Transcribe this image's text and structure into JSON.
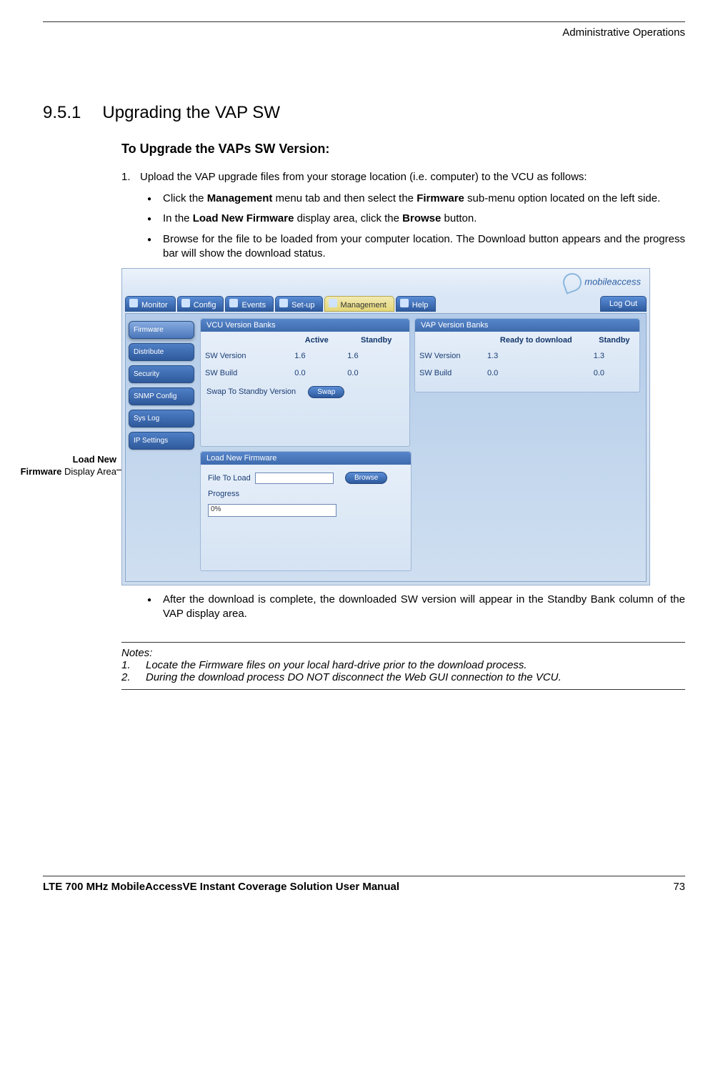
{
  "header_right": "Administrative Operations",
  "section": {
    "num": "9.5.1",
    "title": "Upgrading the VAP SW"
  },
  "sub_h": "To Upgrade the VAPs SW Version:",
  "step1_num": "1.",
  "step1": "Upload the VAP upgrade files from your storage location (i.e. computer) to the VCU as follows:",
  "bullets": {
    "b1_a": "Click the ",
    "b1_b": "Management",
    "b1_c": " menu tab and then select the ",
    "b1_d": "Firmware",
    "b1_e": " sub-menu option located on the left side.",
    "b2_a": "In the ",
    "b2_b": "Load New Firmware",
    "b2_c": " display area, click the ",
    "b2_d": "Browse",
    "b2_e": " button.",
    "b3": "Browse for the file to be loaded from your computer location. The Download button appears and the progress bar will show the download status.",
    "b4": "After the download is complete, the downloaded SW version will appear in the Standby Bank column of the VAP display area."
  },
  "callout_a": "Load New",
  "callout_b": "Firmware",
  "callout_c": " Display Area",
  "app": {
    "brand": "mobileaccess",
    "tabs": [
      "Monitor",
      "Config",
      "Events",
      "Set-up",
      "Management",
      "Help"
    ],
    "selected_tab": "Management",
    "logout": "Log Out",
    "side": [
      "Firmware",
      "Distribute",
      "Security",
      "SNMP Config",
      "Sys Log",
      "IP Settings"
    ],
    "selected_side": "Firmware",
    "vcu": {
      "title": "VCU Version Banks",
      "cols": [
        "",
        "Active",
        "Standby"
      ],
      "rows": [
        [
          "SW Version",
          "1.6",
          "1.6"
        ],
        [
          "SW Build",
          "0.0",
          "0.0"
        ]
      ],
      "swap_label": "Swap To Standby Version",
      "swap_btn": "Swap"
    },
    "vap": {
      "title": "VAP Version Banks",
      "cols": [
        "",
        "Ready to download",
        "Standby"
      ],
      "rows": [
        [
          "SW Version",
          "1.3",
          "1.3"
        ],
        [
          "SW Build",
          "0.0",
          "0.0"
        ]
      ]
    },
    "load": {
      "title": "Load New Firmware",
      "file_label": "File To Load",
      "browse": "Browse",
      "progress_label": "Progress",
      "progress_value": "0%"
    }
  },
  "notes": {
    "h": "Notes:",
    "n1_num": "1.",
    "n1": "Locate the Firmware files on your local hard-drive prior to the download process.",
    "n2_num": "2.",
    "n2": "During the download process DO NOT disconnect the Web GUI connection to the VCU."
  },
  "footer": {
    "left": "LTE 700 MHz MobileAccessVE Instant Coverage Solution User Manual",
    "right": "73"
  }
}
